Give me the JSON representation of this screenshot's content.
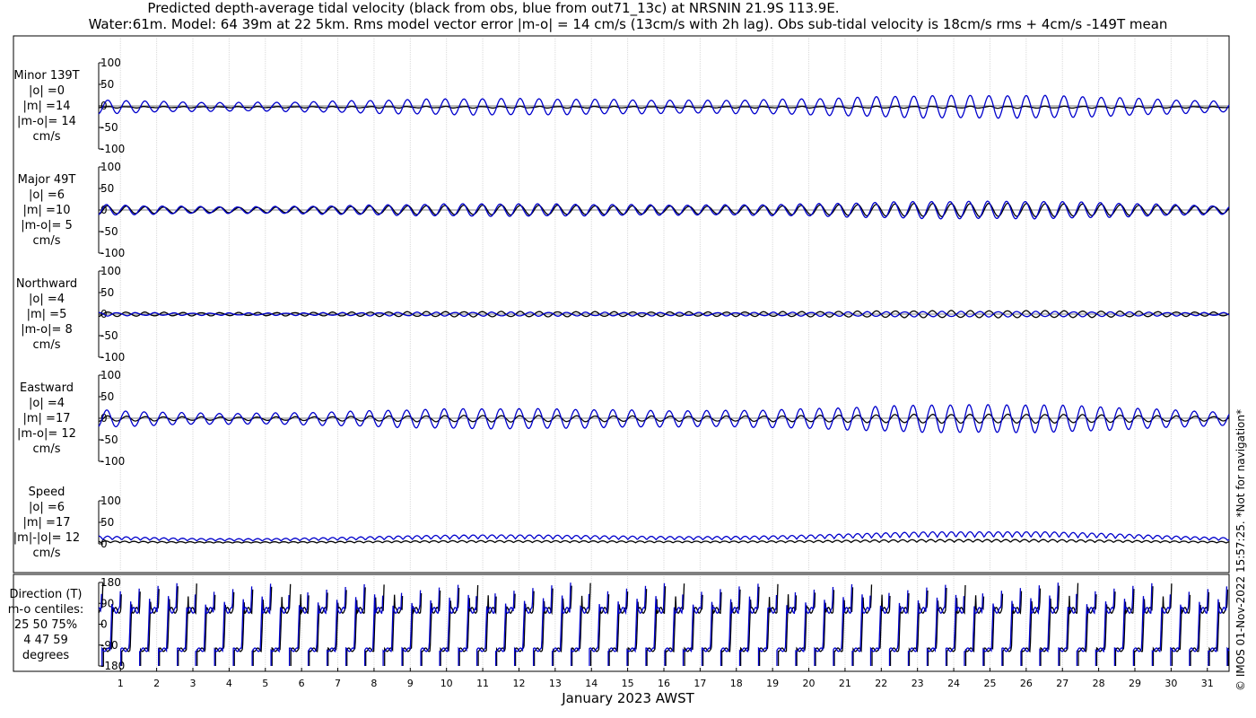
{
  "title_line1": "Predicted depth-average tidal velocity (black from obs, blue from out71_13c) at NRSNIN 21.9S 113.9E.",
  "title_line2": "Water:61m. Model: 64 39m at 22 5km. Rms model vector error |m-o| = 14 cm/s (13cm/s with 2h lag). Obs sub-tidal velocity is 18cm/s rms + 4cm/s -149T mean",
  "copyright": "© IMOS 01-Nov-2022 15:57:25. *Not for navigation*",
  "panel_labels": [
    [
      "Minor 139T",
      "|o| =0",
      "|m| =14",
      "|m-o|= 14",
      "cm/s"
    ],
    [
      "Major 49T",
      "|o| =6",
      "|m| =10",
      "|m-o|= 5",
      "cm/s"
    ],
    [
      "Northward",
      "|o| =4",
      "|m| =5",
      "|m-o|= 8",
      "cm/s"
    ],
    [
      "Eastward",
      "|o| =4",
      "|m| =17",
      "|m-o|= 12",
      "cm/s"
    ],
    [
      "Speed",
      "|o| =6",
      "|m| =17",
      "|m|-|o|= 12",
      "cm/s"
    ],
    [
      "Direction (T)",
      "m-o centiles:",
      "25  50  75%",
      "4  47  59",
      "degrees"
    ]
  ],
  "chart_data": {
    "type": "line",
    "x_unit": "day of January 2023 (AWST)",
    "xlabel": "January 2023 AWST",
    "xlim": [
      0.4,
      31.6
    ],
    "x_ticks": [
      1,
      2,
      3,
      4,
      5,
      6,
      7,
      8,
      9,
      10,
      11,
      12,
      13,
      14,
      15,
      16,
      17,
      18,
      19,
      20,
      21,
      22,
      23,
      24,
      25,
      26,
      27,
      28,
      29,
      30,
      31
    ],
    "tidal_period_hours": 12.42,
    "series_colors": {
      "obs": "#000000",
      "model": "#0000cc"
    },
    "panels": [
      {
        "name": "Minor 139T",
        "ylim": [
          -100,
          100
        ],
        "yticks": [
          -100,
          -50,
          0,
          50,
          100
        ],
        "obs_amplitude": [
          1,
          2
        ],
        "model_amplitude": [
          8,
          26
        ],
        "obs_offset": -3,
        "model_offset": -2,
        "model_phase": 0
      },
      {
        "name": "Major 49T",
        "ylim": [
          -100,
          100
        ],
        "yticks": [
          -100,
          -50,
          0,
          50,
          100
        ],
        "obs_amplitude": [
          5,
          15
        ],
        "model_amplitude": [
          6,
          20
        ],
        "obs_offset": 0,
        "model_offset": 0,
        "model_phase": 0.4
      },
      {
        "name": "Northward",
        "ylim": [
          -100,
          100
        ],
        "yticks": [
          -100,
          -50,
          0,
          50,
          100
        ],
        "obs_amplitude": [
          3,
          8
        ],
        "model_amplitude": [
          2,
          6
        ],
        "obs_offset": 0,
        "model_offset": 0,
        "model_phase": 3.1
      },
      {
        "name": "Eastward",
        "ylim": [
          -100,
          100
        ],
        "yticks": [
          -100,
          -50,
          0,
          50,
          100
        ],
        "obs_amplitude": [
          3,
          10
        ],
        "model_amplitude": [
          10,
          32
        ],
        "obs_offset": -1,
        "model_offset": -1,
        "model_phase": 0.3
      },
      {
        "name": "Speed",
        "ylim": [
          0,
          100
        ],
        "yticks": [
          0,
          50,
          100
        ],
        "obs_mean": [
          4,
          10
        ],
        "model_mean": [
          10,
          28
        ],
        "obs_offset": 0,
        "model_offset": 0
      },
      {
        "name": "Direction (T)",
        "ylim": [
          -180,
          180
        ],
        "yticks": [
          -180,
          -90,
          0,
          90,
          180
        ]
      }
    ]
  }
}
